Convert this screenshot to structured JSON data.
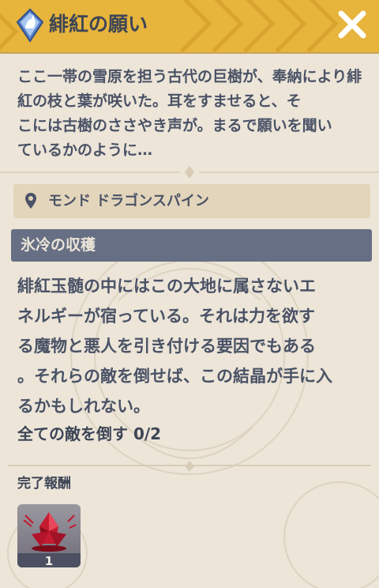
{
  "header": {
    "title": "緋紅の願い",
    "icon": "quest-icon",
    "close_icon": "close-icon"
  },
  "description": "ここ一帯の雪原を担う古代の巨樹が、奉納により緋紅の枝と葉が咲いた。耳をすませると、そ\nこには古樹のささやき声が。まるで願いを聞い\nているかのように…",
  "location": {
    "icon": "location-pin-icon",
    "text": "モンド ドラゴンスパイン"
  },
  "objective": {
    "title": "氷冷の収穫",
    "body": "緋紅玉髄の中にはこの大地に属さないエ\nネルギーが宿っている。それは力を欲す\nる魔物と悪人を引き付ける要因でもある\n。それらの敵を倒せば、この結晶が手に入\nるかもしれない。",
    "progress": "全ての敵を倒す 0/2"
  },
  "rewards": {
    "label": "完了報酬",
    "items": [
      {
        "icon": "crimson-agate-icon",
        "count": "1"
      }
    ]
  },
  "colors": {
    "header": "#e7b43c",
    "background": "#ece5d8",
    "objective_bar": "#666f84",
    "location_box": "#e3d5bb",
    "text": "#4a5266"
  }
}
